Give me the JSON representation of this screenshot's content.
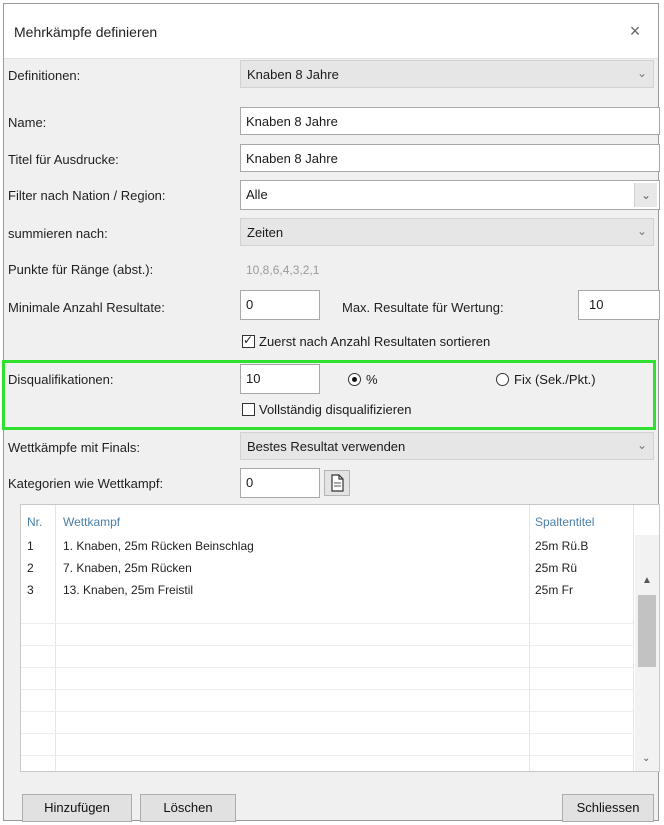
{
  "window": {
    "title": "Mehrkämpfe definieren",
    "close_glyph": "×"
  },
  "form": {
    "definitionen": {
      "label": "Definitionen:",
      "value": "Knaben  8 Jahre"
    },
    "name": {
      "label": "Name:",
      "value": "Knaben  8 Jahre"
    },
    "titel": {
      "label": "Titel für Ausdrucke:",
      "value": "Knaben  8 Jahre"
    },
    "filter": {
      "label": "Filter nach Nation / Region:",
      "value": "Alle"
    },
    "summieren": {
      "label": "summieren nach:",
      "value": "Zeiten"
    },
    "punkte": {
      "label": "Punkte für Ränge (abst.):",
      "value": "10,8,6,4,3,2,1"
    },
    "min_resultate": {
      "label": "Minimale Anzahl Resultate:",
      "value": "0"
    },
    "max_resultate": {
      "label": "Max. Resultate für Wertung:",
      "value": "10"
    },
    "sortieren": {
      "label": "Zuerst nach Anzahl Resultaten sortieren",
      "checked": true
    },
    "disqualifikationen": {
      "label": "Disqualifikationen:",
      "value": "10",
      "option_percent": "%",
      "option_fix": "Fix (Sek./Pkt.)",
      "selected": "percent",
      "vollstaendig": {
        "label": "Vollständig disqualifizieren",
        "checked": false
      }
    },
    "wettkaempfe_finals": {
      "label": "Wettkämpfe mit Finals:",
      "value": "Bestes Resultat verwenden"
    },
    "kategorien": {
      "label": "Kategorien wie Wettkampf:",
      "value": "0"
    }
  },
  "table": {
    "headers": {
      "nr": "Nr.",
      "wettkampf": "Wettkampf",
      "spaltentitel": "Spaltentitel"
    },
    "rows": [
      {
        "nr": "1",
        "wettkampf": "1. Knaben, 25m Rücken Beinschlag",
        "spaltentitel": "25m Rü.B"
      },
      {
        "nr": "2",
        "wettkampf": "7. Knaben, 25m Rücken",
        "spaltentitel": "25m Rü"
      },
      {
        "nr": "3",
        "wettkampf": "13. Knaben, 25m Freistil",
        "spaltentitel": "25m Fr"
      }
    ]
  },
  "buttons": {
    "add": "Hinzufügen",
    "delete": "Löschen",
    "close": "Schliessen"
  },
  "colors": {
    "highlight": "#2fe02f",
    "header_text": "#4a7fa8"
  }
}
